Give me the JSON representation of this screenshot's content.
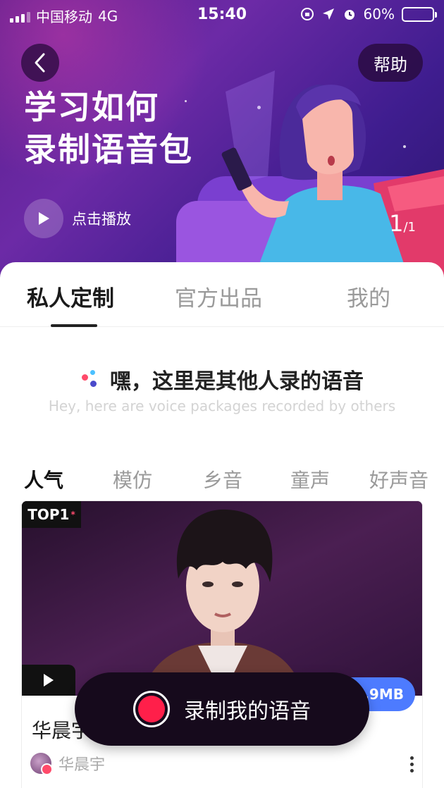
{
  "status_bar": {
    "carrier": "中国移动",
    "network": "4G",
    "time": "15:40",
    "battery_percent": "60%",
    "battery_level": 0.6,
    "battery_color": "#ffd21c"
  },
  "banner": {
    "help_label": "帮助",
    "title_line1": "学习如何",
    "title_line2": "录制语音包",
    "play_label": "点击播放",
    "page_current": "1",
    "page_total": "/1"
  },
  "tabs": [
    {
      "label": "私人定制",
      "active": true
    },
    {
      "label": "官方出品",
      "active": false
    },
    {
      "label": "我的",
      "active": false
    }
  ],
  "intro": {
    "title": "嘿，这里是其他人录的语音",
    "subtitle": "Hey, here are voice packages recorded by others"
  },
  "categories": [
    {
      "label": "人气",
      "active": true
    },
    {
      "label": "模仿",
      "active": false
    },
    {
      "label": "乡音",
      "active": false
    },
    {
      "label": "童声",
      "active": false
    },
    {
      "label": "好声音",
      "active": false
    }
  ],
  "card": {
    "badge": "TOP1",
    "badge_mark": "*",
    "size": ".9MB",
    "title": "华晨宇",
    "author": "华晨宇"
  },
  "record_button": {
    "label": "录制我的语音",
    "accent": "#ff1f4a"
  },
  "icons": {
    "back": "chevron-left-icon",
    "play": "play-icon",
    "record": "record-icon",
    "more": "more-vertical-icon"
  }
}
